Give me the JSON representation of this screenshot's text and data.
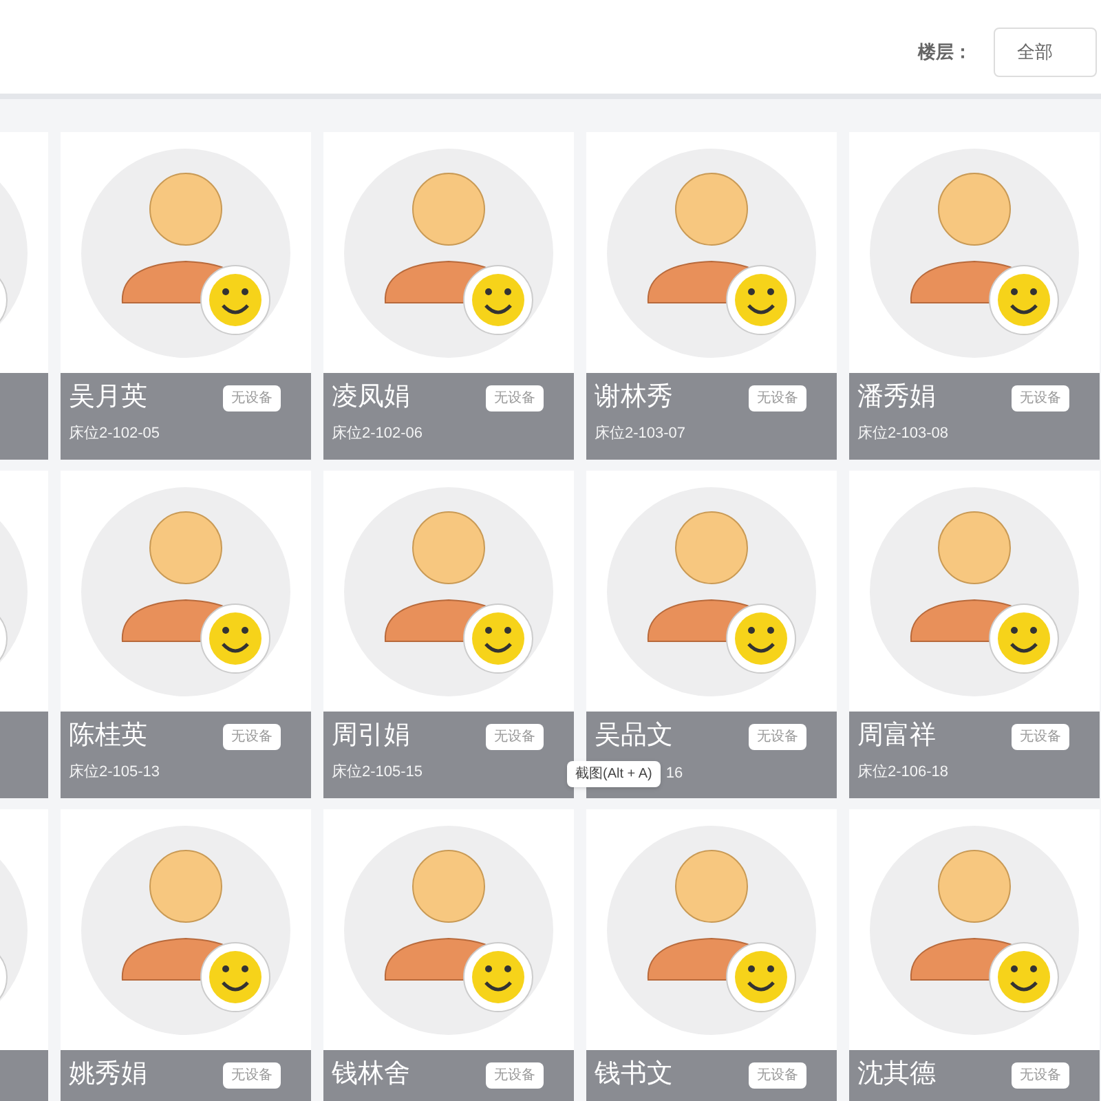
{
  "filter": {
    "label": "楼层：",
    "value": "全部"
  },
  "rows": [
    {
      "cards": [
        {
          "name": "吴月英",
          "badge": "无设备",
          "bed": "床位2-102-05"
        },
        {
          "name": "凌凤娟",
          "badge": "无设备",
          "bed": "床位2-102-06"
        },
        {
          "name": "谢林秀",
          "badge": "无设备",
          "bed": "床位2-103-07"
        },
        {
          "name": "潘秀娟",
          "badge": "无设备",
          "bed": "床位2-103-08"
        }
      ]
    },
    {
      "cards": [
        {
          "name": "陈桂英",
          "badge": "无设备",
          "bed": "床位2-105-13"
        },
        {
          "name": "周引娟",
          "badge": "无设备",
          "bed": "床位2-105-15"
        },
        {
          "name": "吴品文",
          "badge": "无设备",
          "bed": "16",
          "tooltip": "截图(Alt + A)"
        },
        {
          "name": "周富祥",
          "badge": "无设备",
          "bed": "床位2-106-18"
        }
      ]
    },
    {
      "cards": [
        {
          "name": "姚秀娟",
          "badge": "无设备"
        },
        {
          "name": "钱林舍",
          "badge": "无设备"
        },
        {
          "name": "钱书文",
          "badge": "无设备"
        },
        {
          "name": "沈其德",
          "badge": "无设备"
        }
      ]
    }
  ]
}
